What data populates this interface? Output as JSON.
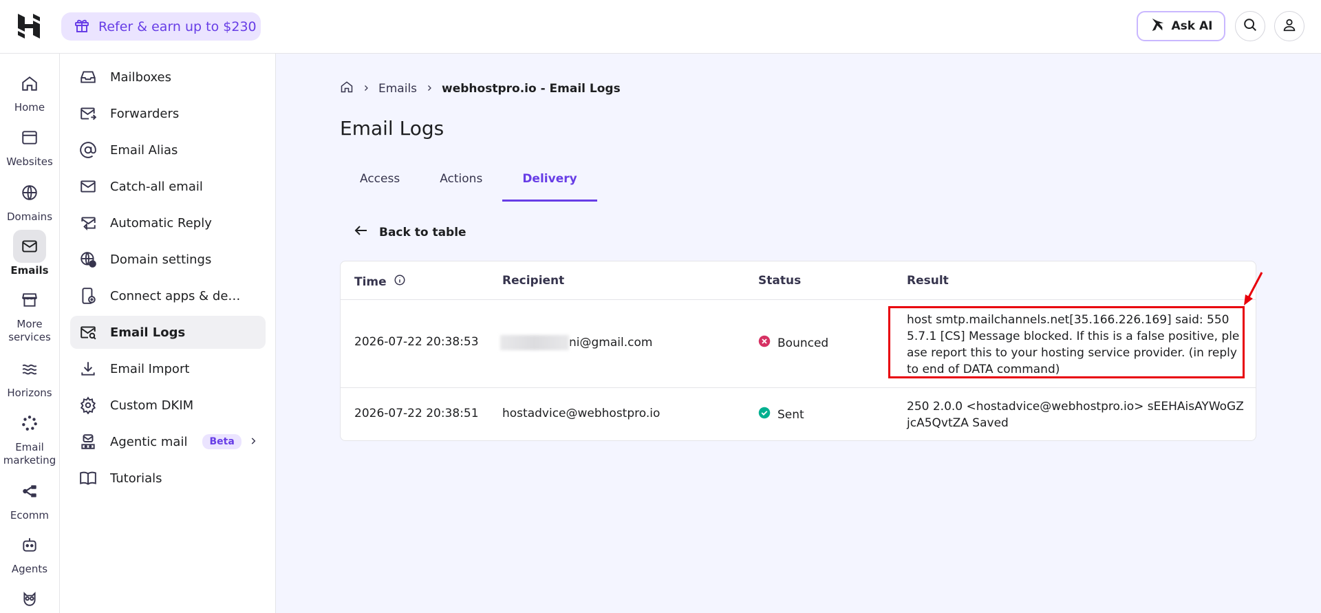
{
  "topbar": {
    "refer_label": "Refer & earn up to $230",
    "ask_ai_label": "Ask AI"
  },
  "rail": {
    "items": [
      {
        "label": "Home"
      },
      {
        "label": "Websites"
      },
      {
        "label": "Domains"
      },
      {
        "label": "Emails"
      },
      {
        "label": "More\nservices"
      },
      {
        "label": "Horizons"
      },
      {
        "label": "Email\nmarketing"
      },
      {
        "label": "Ecomm"
      },
      {
        "label": "Agents"
      }
    ]
  },
  "subnav": {
    "items": [
      {
        "label": "Mailboxes"
      },
      {
        "label": "Forwarders"
      },
      {
        "label": "Email Alias"
      },
      {
        "label": "Catch-all email"
      },
      {
        "label": "Automatic Reply"
      },
      {
        "label": "Domain settings"
      },
      {
        "label": "Connect apps & devic..."
      },
      {
        "label": "Email Logs"
      },
      {
        "label": "Email Import"
      },
      {
        "label": "Custom DKIM"
      },
      {
        "label": "Agentic mail",
        "badge": "Beta"
      },
      {
        "label": "Tutorials"
      }
    ]
  },
  "breadcrumb": {
    "parent": "Emails",
    "current": "webhostpro.io - Email Logs"
  },
  "page_title": "Email Logs",
  "tabs": [
    {
      "label": "Access"
    },
    {
      "label": "Actions"
    },
    {
      "label": "Delivery"
    }
  ],
  "back_label": "Back to table",
  "table": {
    "headers": {
      "time": "Time",
      "recipient": "Recipient",
      "status": "Status",
      "result": "Result"
    },
    "rows": [
      {
        "time": "2026-07-22 20:38:53",
        "recipient": "ni@gmail.com",
        "status": "Bounced",
        "result": "host smtp.mailchannels.net[35.166.226.169] said: 550 5.7.1 [CS] Message blocked. If this is a false positive, please report this to your hosting service provider. (in reply to end of DATA command)"
      },
      {
        "time": "2026-07-22 20:38:51",
        "recipient": "hostadvice@webhostpro.io",
        "status": "Sent",
        "result": "250 2.0.0 <hostadvice@webhostpro.io> sEEHAisAYWoGZjcA5QvtZA Saved"
      }
    ]
  },
  "colors": {
    "accent": "#673de6",
    "bounced": "#d63163",
    "sent": "#00b090",
    "annotation": "#e8000b"
  }
}
